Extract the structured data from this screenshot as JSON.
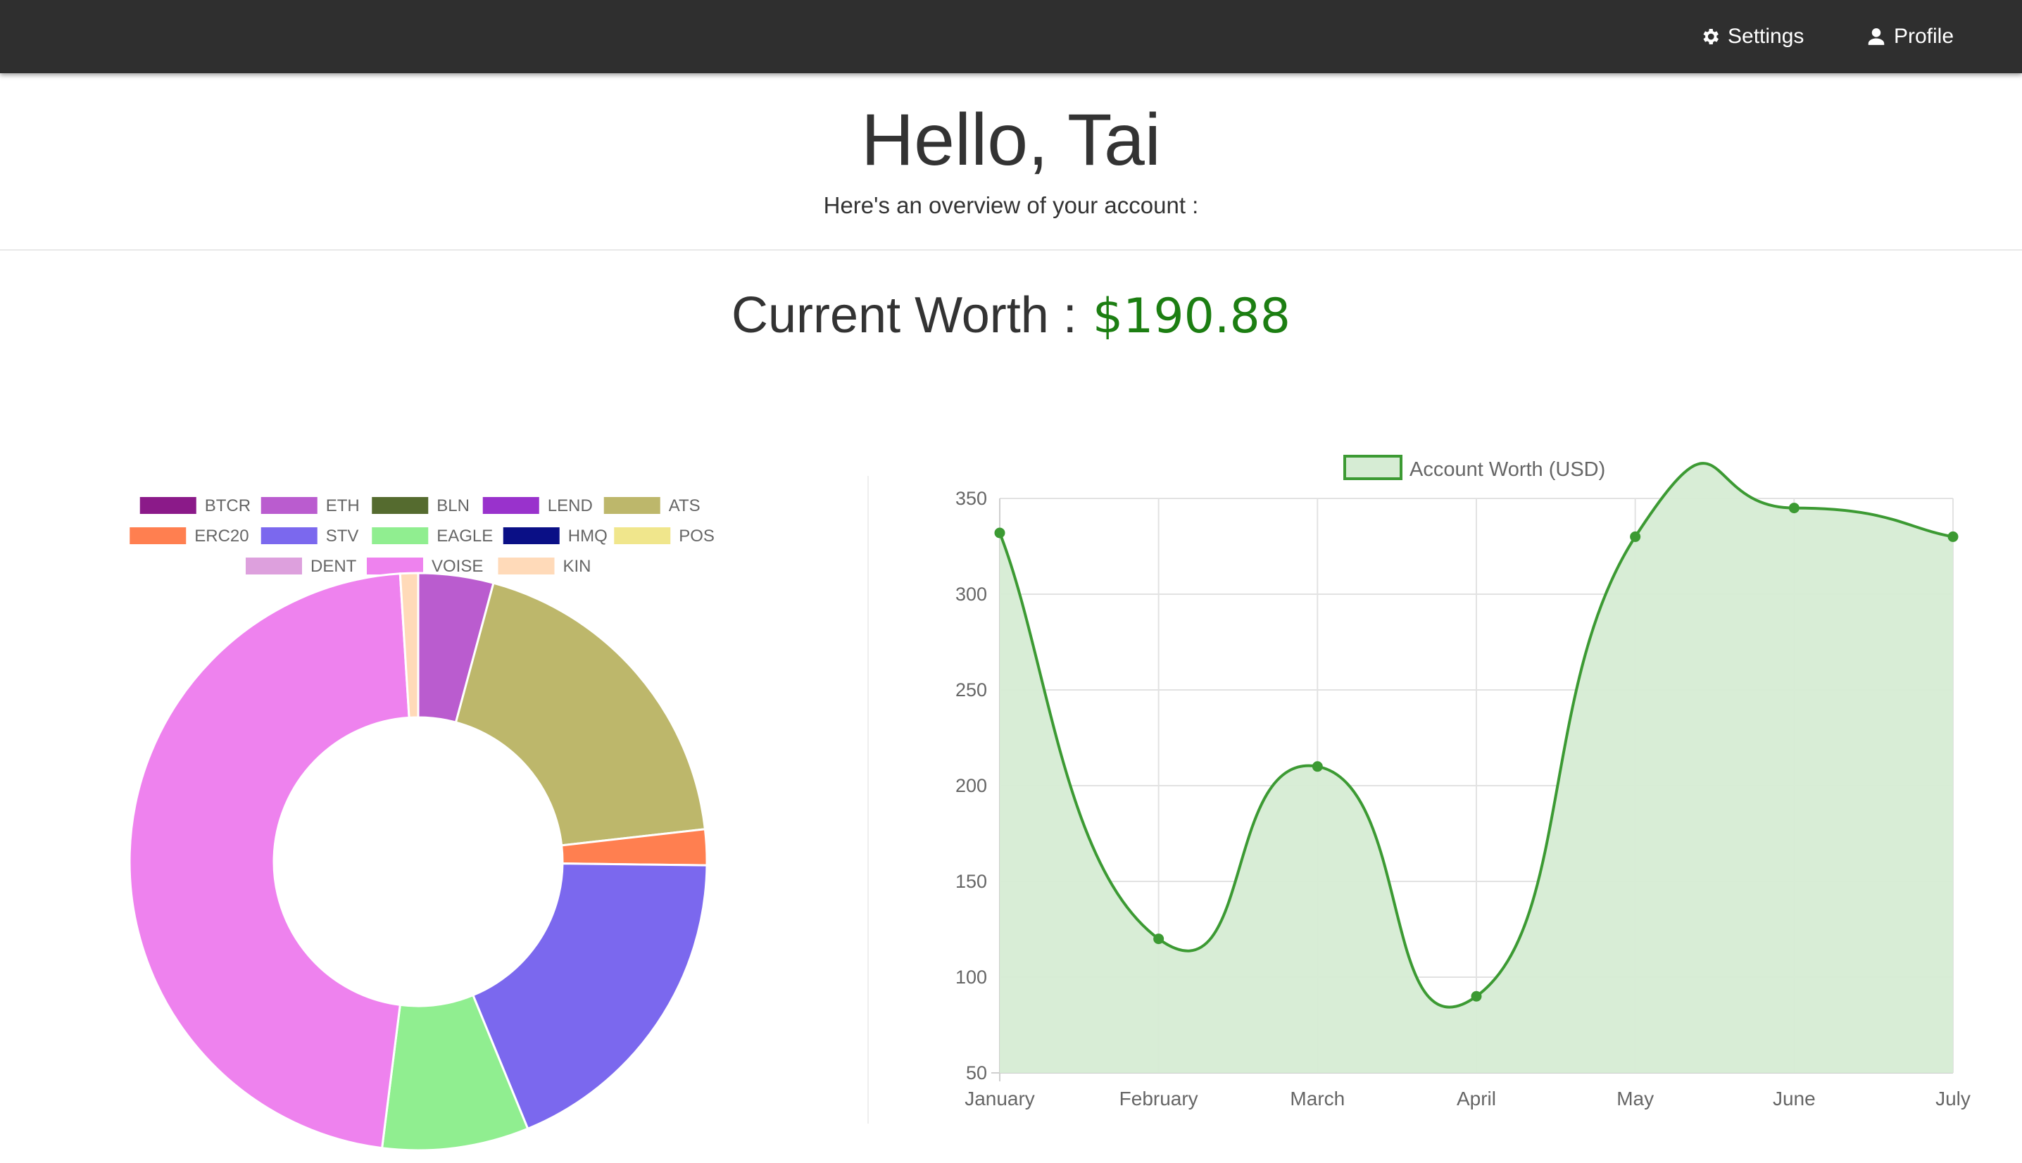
{
  "navbar": {
    "settings_label": "Settings",
    "profile_label": "Profile",
    "settings_icon": "gear-icon",
    "profile_icon": "user-icon"
  },
  "header": {
    "greeting": "Hello, Tai",
    "subtitle": "Here's an overview of your account :"
  },
  "worth": {
    "label": "Current Worth :",
    "value": "$190.88"
  },
  "colors": {
    "navbar_bg": "#2f2f2f",
    "worth_value": "#1c7e12",
    "line": "#3c9a33",
    "area_fill": "#d6ecd4"
  },
  "chart_data": [
    {
      "type": "pie",
      "variant": "doughnut",
      "legend_position": "top",
      "labels": [
        "BTCR",
        "ETH",
        "BLN",
        "LEND",
        "ATS",
        "ERC20",
        "STV",
        "EAGLE",
        "HMQ",
        "POS",
        "DENT",
        "VOISE",
        "KIN"
      ],
      "colors": [
        "#8b1a89",
        "#ba5ccf",
        "#556b2f",
        "#9932cc",
        "#bdb76b",
        "#ff7f50",
        "#7b68ee",
        "#90ee90",
        "#0a0f86",
        "#f0e68c",
        "#dda0dd",
        "#ee82ee",
        "#ffdab9"
      ],
      "values": [
        0,
        4.2,
        0,
        0,
        19.0,
        2.0,
        18.6,
        8.2,
        0,
        0,
        0,
        47.0,
        1.0
      ]
    },
    {
      "type": "area",
      "legend_position": "top",
      "categories": [
        "January",
        "February",
        "March",
        "April",
        "May",
        "June",
        "July"
      ],
      "series": [
        {
          "name": "Account Worth (USD)",
          "values": [
            332,
            120,
            210,
            90,
            330,
            345,
            330
          ]
        }
      ],
      "ylim": [
        50,
        350
      ],
      "yticks": [
        350,
        300,
        250,
        200,
        150,
        100,
        50
      ],
      "grid": true
    }
  ]
}
